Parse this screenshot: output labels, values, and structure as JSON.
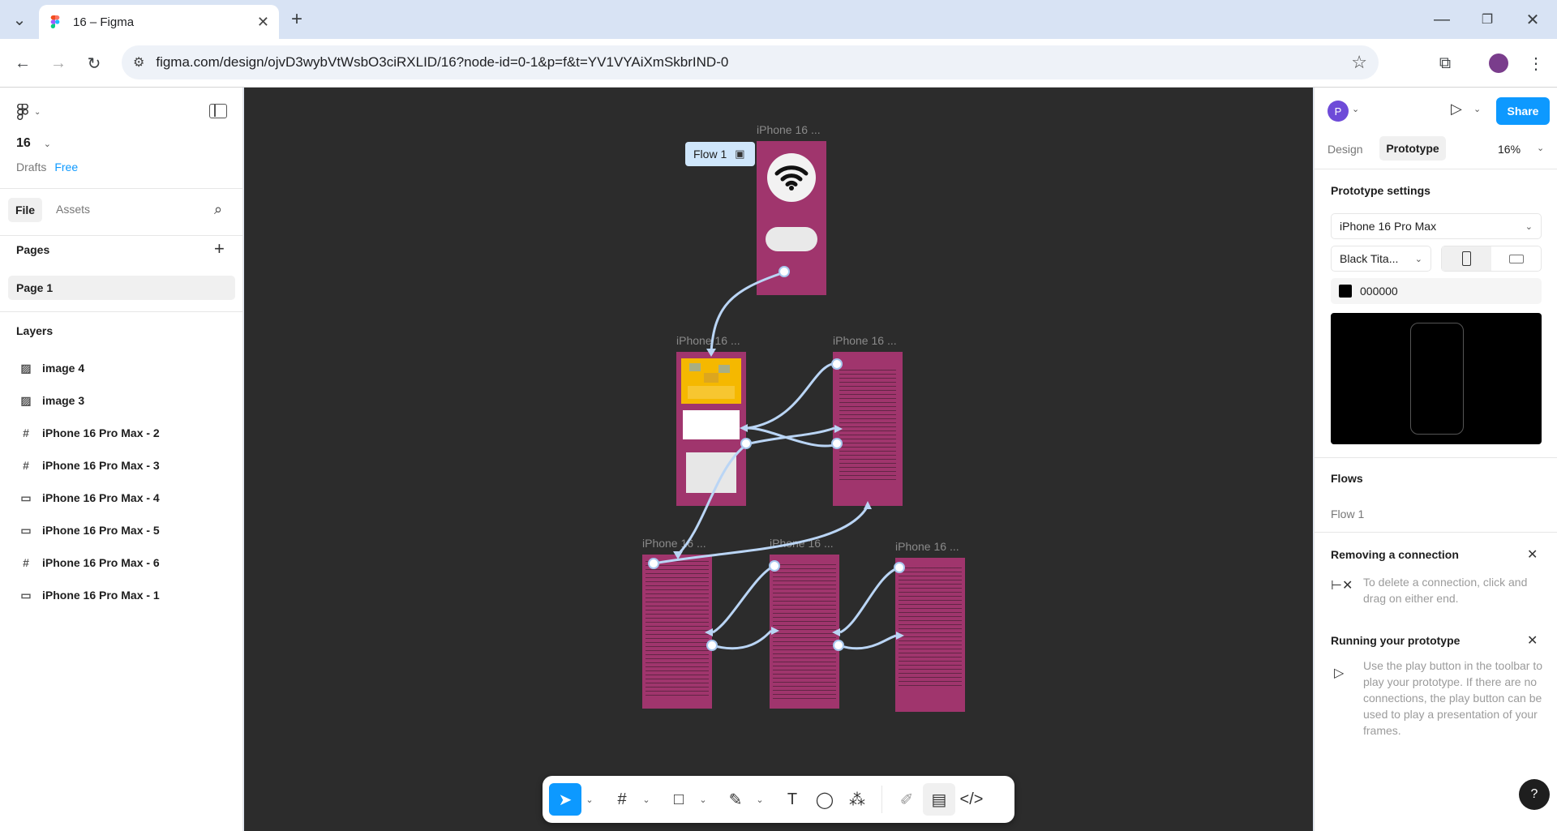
{
  "browser": {
    "tab_title": "16 – Figma",
    "url": "figma.com/design/ojvD3wybVtWsbO3ciRXLID/16?node-id=0-1&p=f&t=YV1VYAiXmSkbrIND-0"
  },
  "left_panel": {
    "file_name": "16",
    "location": "Drafts",
    "plan": "Free",
    "tabs": [
      "File",
      "Assets"
    ],
    "pages_title": "Pages",
    "pages": [
      "Page 1"
    ],
    "layers_title": "Layers",
    "layers": [
      {
        "name": "image 4",
        "icon": "image-icon"
      },
      {
        "name": "image 3",
        "icon": "image-icon"
      },
      {
        "name": "iPhone 16 Pro Max - 2",
        "icon": "frame-icon"
      },
      {
        "name": "iPhone 16 Pro Max - 3",
        "icon": "frame-icon"
      },
      {
        "name": "iPhone 16 Pro Max - 4",
        "icon": "rectangle-icon"
      },
      {
        "name": "iPhone 16 Pro Max - 5",
        "icon": "rectangle-icon"
      },
      {
        "name": "iPhone 16 Pro Max - 6",
        "icon": "frame-icon"
      },
      {
        "name": "iPhone 16 Pro Max - 1",
        "icon": "rectangle-icon"
      }
    ]
  },
  "canvas": {
    "flow_label": "Flow 1",
    "frame_label": "iPhone 16 ...",
    "frame_label_cut": "iPhone 16 ..."
  },
  "right_panel": {
    "avatar_initial": "P",
    "share_label": "Share",
    "tabs": [
      "Design",
      "Prototype"
    ],
    "zoom": "16%",
    "prototype_settings_title": "Prototype settings",
    "device": "iPhone 16 Pro Max",
    "model": "Black Tita...",
    "bg_color": "000000",
    "flows_title": "Flows",
    "flow_name": "Flow 1",
    "removing_title": "Removing a connection",
    "removing_text": "To delete a connection, click and drag on either end.",
    "running_title": "Running your prototype",
    "running_text": "Use the play button in the toolbar to play your prototype. If there are no connections, the play button can be used to play a presentation of your frames.",
    "help": "?"
  },
  "colors": {
    "frame_bg": "#a0356d",
    "accent": "#0d99ff",
    "canvas_bg": "#2c2c2c"
  }
}
